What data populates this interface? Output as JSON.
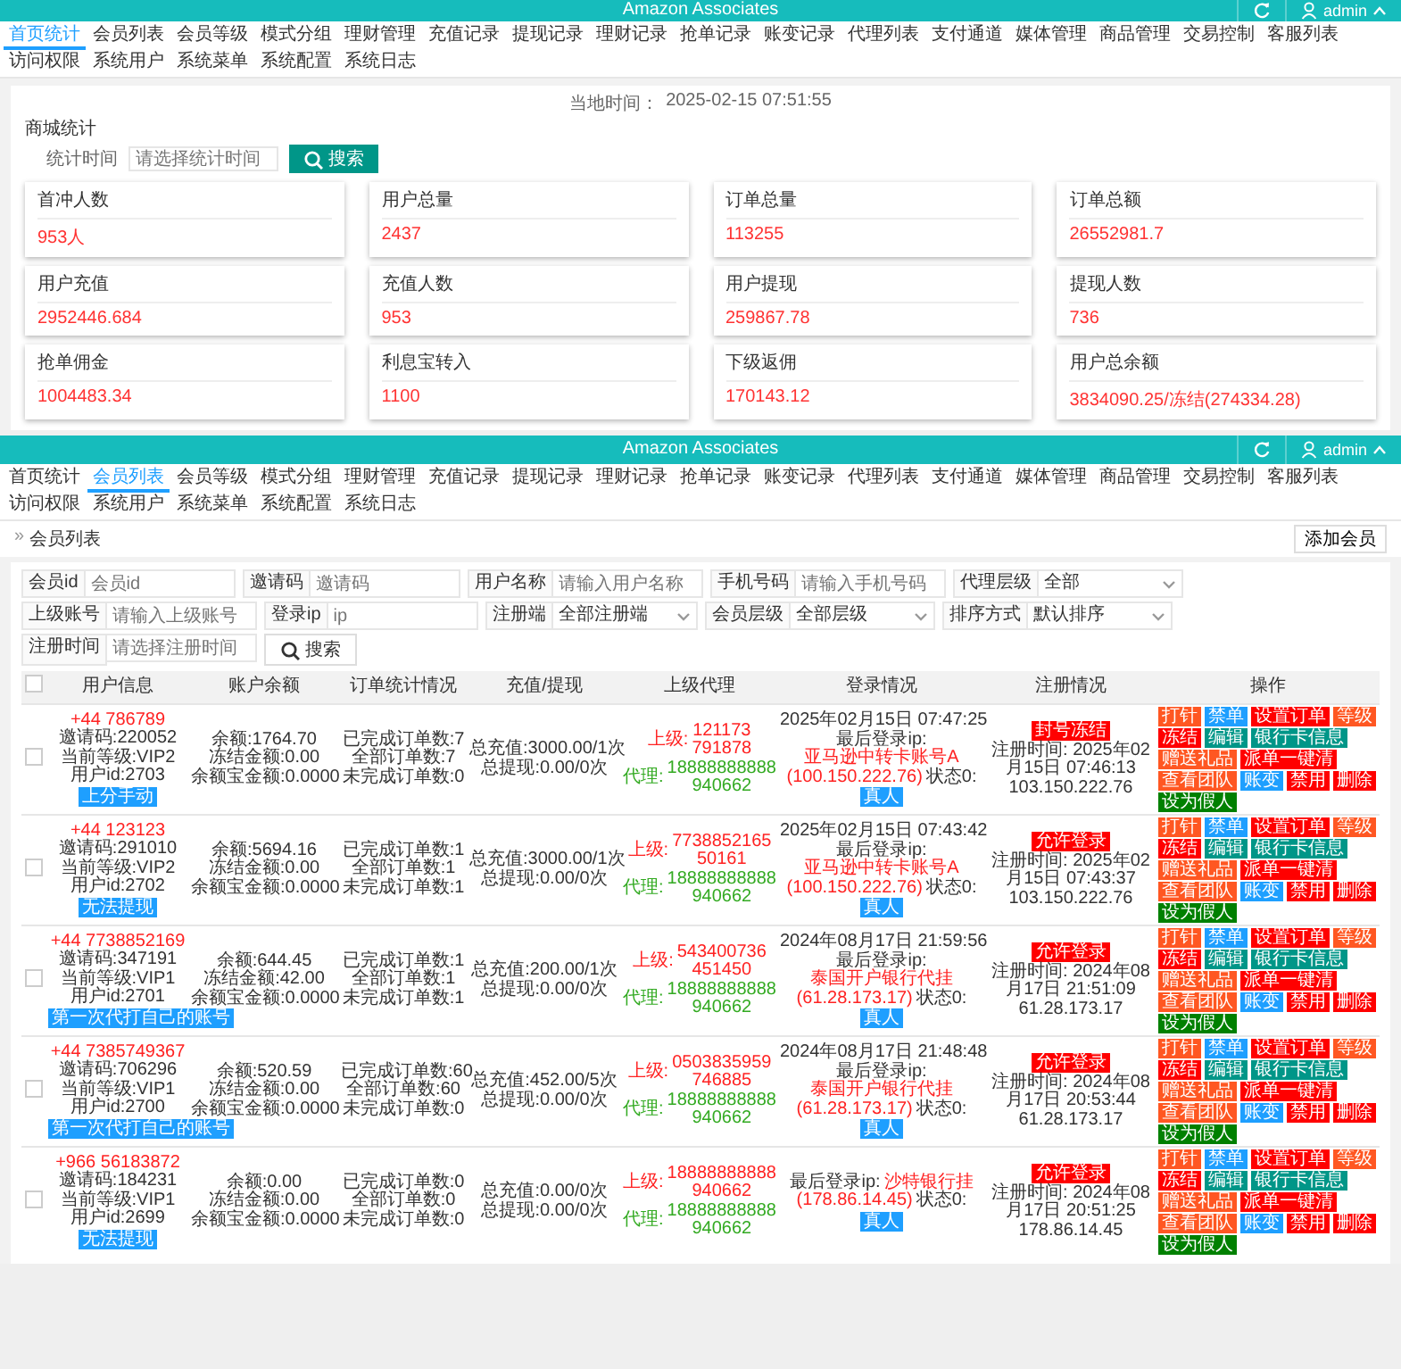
{
  "dashboard": {
    "window_title": "Amazon Associates",
    "user": "admin",
    "nav": [
      {
        "label": "首页统计",
        "selected": true
      },
      {
        "label": "会员列表",
        "selected": false
      },
      {
        "label": "会员等级",
        "selected": false
      },
      {
        "label": "模式分组",
        "selected": false
      },
      {
        "label": "理财管理",
        "selected": false
      },
      {
        "label": "充值记录",
        "selected": false
      },
      {
        "label": "提现记录",
        "selected": false
      },
      {
        "label": "理财记录",
        "selected": false
      },
      {
        "label": "抢单记录",
        "selected": false
      },
      {
        "label": "账变记录",
        "selected": false
      },
      {
        "label": "代理列表",
        "selected": false
      },
      {
        "label": "支付通道",
        "selected": false
      },
      {
        "label": "媒体管理",
        "selected": false
      },
      {
        "label": "商品管理",
        "selected": false
      },
      {
        "label": "交易控制",
        "selected": false
      },
      {
        "label": "客服列表",
        "selected": false
      },
      {
        "label": "访问权限",
        "selected": false
      },
      {
        "label": "系统用户",
        "selected": false
      },
      {
        "label": "系统菜单",
        "selected": false
      },
      {
        "label": "系统配置",
        "selected": false
      },
      {
        "label": "系统日志",
        "selected": false
      }
    ],
    "local_time_label": "当地时间：",
    "local_time": "2025-02-15 07:51:55",
    "section_title": "商城统计",
    "filter": {
      "label": "统计时间",
      "placeholder": "请选择统计时间"
    },
    "search_button": "搜索",
    "cards": [
      {
        "label": "首冲人数",
        "value": "953人"
      },
      {
        "label": "用户总量",
        "value": "2437"
      },
      {
        "label": "订单总量",
        "value": "113255"
      },
      {
        "label": "订单总额",
        "value": "26552981.7"
      },
      {
        "label": "用户充值",
        "value": "2952446.684"
      },
      {
        "label": "充值人数",
        "value": "953"
      },
      {
        "label": "用户提现",
        "value": "259867.78"
      },
      {
        "label": "提现人数",
        "value": "736"
      },
      {
        "label": "抢单佣金",
        "value": "1004483.34"
      },
      {
        "label": "利息宝转入",
        "value": "1100"
      },
      {
        "label": "下级返佣",
        "value": "170143.12"
      },
      {
        "label": "用户总余额",
        "value": "3834090.25/冻结(274334.28)"
      }
    ]
  },
  "member_list": {
    "window_title": "Amazon Associates",
    "user": "admin",
    "nav": [
      {
        "label": "首页统计",
        "selected": false
      },
      {
        "label": "会员列表",
        "selected": true
      },
      {
        "label": "会员等级",
        "selected": false
      },
      {
        "label": "模式分组",
        "selected": false
      },
      {
        "label": "理财管理",
        "selected": false
      },
      {
        "label": "充值记录",
        "selected": false
      },
      {
        "label": "提现记录",
        "selected": false
      },
      {
        "label": "理财记录",
        "selected": false
      },
      {
        "label": "抢单记录",
        "selected": false
      },
      {
        "label": "账变记录",
        "selected": false
      },
      {
        "label": "代理列表",
        "selected": false
      },
      {
        "label": "支付通道",
        "selected": false
      },
      {
        "label": "媒体管理",
        "selected": false
      },
      {
        "label": "商品管理",
        "selected": false
      },
      {
        "label": "交易控制",
        "selected": false
      },
      {
        "label": "客服列表",
        "selected": false
      },
      {
        "label": "访问权限",
        "selected": false
      },
      {
        "label": "系统用户",
        "selected": false
      },
      {
        "label": "系统菜单",
        "selected": false
      },
      {
        "label": "系统配置",
        "selected": false
      },
      {
        "label": "系统日志",
        "selected": false
      }
    ],
    "breadcrumb_mark": "»",
    "breadcrumb": "会员列表",
    "add_button": "添加会员",
    "filters": [
      {
        "kind": "input",
        "label": "会员id",
        "placeholder": "会员id"
      },
      {
        "kind": "input",
        "label": "邀请码",
        "placeholder": "邀请码"
      },
      {
        "kind": "input",
        "label": "用户名称",
        "placeholder": "请输入用户名称"
      },
      {
        "kind": "input",
        "label": "手机号码",
        "placeholder": "请输入手机号码"
      },
      {
        "kind": "select",
        "label": "代理层级",
        "value": "全部"
      },
      {
        "kind": "input",
        "label": "上级账号",
        "placeholder": "请输入上级账号"
      },
      {
        "kind": "input",
        "label": "登录ip",
        "placeholder": "ip"
      },
      {
        "kind": "select",
        "label": "注册端",
        "value": "全部注册端"
      },
      {
        "kind": "select",
        "label": "会员层级",
        "value": "全部层级"
      },
      {
        "kind": "select",
        "label": "排序方式",
        "value": "默认排序"
      },
      {
        "kind": "input",
        "label": "注册时间",
        "placeholder": "请选择注册时间"
      }
    ],
    "search_button": "搜索",
    "select_all": {
      "checked": false
    },
    "columns": [
      "用户信息",
      "账户余额",
      "订单统计情况",
      "充值/提现",
      "上级代理",
      "登录情况",
      "注册情况",
      "操作"
    ],
    "rows": [
      {
        "checked": false,
        "phone": "+44 786789",
        "details": [
          "邀请码:220052",
          "当前等级:VIP2",
          "用户id:2703"
        ],
        "tag": "上分手动",
        "balance": [
          "余额:1764.70",
          "冻结金额:0.00",
          "余额宝金额:0.0000"
        ],
        "orders": [
          "已完成订单数:7",
          "全部订单数:7",
          "未完成订单数:0"
        ],
        "recharge": [
          "总充值:3000.00/1次",
          "总提现:0.00/0次"
        ],
        "superior": {
          "label": "上级:",
          "ids": [
            "121173",
            "791878"
          ]
        },
        "agent": {
          "label": "代理:",
          "ids": [
            "18888888888",
            "940662"
          ]
        },
        "login": {
          "time": "2025年02月15日 07:47:25",
          "ip_label": "最后登录ip:",
          "ip_name": "亚马逊中转卡账号A",
          "ip": "(100.150.222.76)",
          "status": "状态0:",
          "tag": "真人"
        },
        "register": {
          "badge": "封号冻结",
          "time": "注册时间: 2025年02月15日 07:46:13",
          "ip": "103.150.222.76"
        },
        "actions": [
          {
            "label": "打针",
            "color": "#ff5722"
          },
          {
            "label": "禁单",
            "color": "#1e9fff"
          },
          {
            "label": "设置订单",
            "color": "#ff0000"
          },
          {
            "label": "等级",
            "color": "#ff5722"
          },
          {
            "label": "冻结",
            "color": "#ff0000"
          },
          {
            "label": "编辑",
            "color": "#009688"
          },
          {
            "label": "银行卡信息",
            "color": "#009688"
          },
          {
            "label": "赠送礼品",
            "color": "#ff5722"
          },
          {
            "label": "派单一键清",
            "color": "#ff0000"
          },
          {
            "label": "查看团队",
            "color": "#ff5722"
          },
          {
            "label": "账变",
            "color": "#1e9fff"
          },
          {
            "label": "禁用",
            "color": "#ff0000"
          },
          {
            "label": "删除",
            "color": "#ff0000"
          },
          {
            "label": "设为假人",
            "color": "#008000"
          }
        ]
      },
      {
        "checked": false,
        "phone": "+44 123123",
        "details": [
          "邀请码:291010",
          "当前等级:VIP2",
          "用户id:2702"
        ],
        "tag": "无法提现",
        "balance": [
          "余额:5694.16",
          "冻结金额:0.00",
          "余额宝金额:0.0000"
        ],
        "orders": [
          "已完成订单数:1",
          "全部订单数:1",
          "未完成订单数:1"
        ],
        "recharge": [
          "总充值:3000.00/1次",
          "总提现:0.00/0次"
        ],
        "superior": {
          "label": "上级:",
          "ids": [
            "7738852165",
            "50161"
          ]
        },
        "agent": {
          "label": "代理:",
          "ids": [
            "18888888888",
            "940662"
          ]
        },
        "login": {
          "time": "2025年02月15日 07:43:42",
          "ip_label": "最后登录ip:",
          "ip_name": "亚马逊中转卡账号A",
          "ip": "(100.150.222.76)",
          "status": "状态0:",
          "tag": "真人"
        },
        "register": {
          "badge": "允许登录",
          "time": "注册时间: 2025年02月15日 07:43:37",
          "ip": "103.150.222.76"
        },
        "actions": [
          {
            "label": "打针",
            "color": "#ff5722"
          },
          {
            "label": "禁单",
            "color": "#1e9fff"
          },
          {
            "label": "设置订单",
            "color": "#ff0000"
          },
          {
            "label": "等级",
            "color": "#ff5722"
          },
          {
            "label": "冻结",
            "color": "#ff0000"
          },
          {
            "label": "编辑",
            "color": "#009688"
          },
          {
            "label": "银行卡信息",
            "color": "#009688"
          },
          {
            "label": "赠送礼品",
            "color": "#ff5722"
          },
          {
            "label": "派单一键清",
            "color": "#ff0000"
          },
          {
            "label": "查看团队",
            "color": "#ff5722"
          },
          {
            "label": "账变",
            "color": "#1e9fff"
          },
          {
            "label": "禁用",
            "color": "#ff0000"
          },
          {
            "label": "删除",
            "color": "#ff0000"
          },
          {
            "label": "设为假人",
            "color": "#008000"
          }
        ]
      },
      {
        "checked": false,
        "phone": "+44 7738852169",
        "details": [
          "邀请码:347191",
          "当前等级:VIP1",
          "用户id:2701"
        ],
        "tag": "第一次代打自己的账号",
        "balance": [
          "余额:644.45",
          "冻结金额:42.00",
          "余额宝金额:0.0000"
        ],
        "orders": [
          "已完成订单数:1",
          "全部订单数:1",
          "未完成订单数:1"
        ],
        "recharge": [
          "总充值:200.00/1次",
          "总提现:0.00/0次"
        ],
        "superior": {
          "label": "上级:",
          "ids": [
            "543400736",
            "451450"
          ]
        },
        "agent": {
          "label": "代理:",
          "ids": [
            "18888888888",
            "940662"
          ]
        },
        "login": {
          "time": "2024年08月17日 21:59:56",
          "ip_label": "最后登录ip:",
          "ip_name": "泰国开户银行代挂",
          "ip": "(61.28.173.17)",
          "status": "状态0:",
          "tag": "真人"
        },
        "register": {
          "badge": "允许登录",
          "time": "注册时间: 2024年08月17日 21:51:09",
          "ip": "61.28.173.17"
        },
        "actions": [
          {
            "label": "打针",
            "color": "#ff5722"
          },
          {
            "label": "禁单",
            "color": "#1e9fff"
          },
          {
            "label": "设置订单",
            "color": "#ff0000"
          },
          {
            "label": "等级",
            "color": "#ff5722"
          },
          {
            "label": "冻结",
            "color": "#ff0000"
          },
          {
            "label": "编辑",
            "color": "#009688"
          },
          {
            "label": "银行卡信息",
            "color": "#009688"
          },
          {
            "label": "赠送礼品",
            "color": "#ff5722"
          },
          {
            "label": "派单一键清",
            "color": "#ff0000"
          },
          {
            "label": "查看团队",
            "color": "#ff5722"
          },
          {
            "label": "账变",
            "color": "#1e9fff"
          },
          {
            "label": "禁用",
            "color": "#ff0000"
          },
          {
            "label": "删除",
            "color": "#ff0000"
          },
          {
            "label": "设为假人",
            "color": "#008000"
          }
        ]
      },
      {
        "checked": false,
        "phone": "+44 7385749367",
        "details": [
          "邀请码:706296",
          "当前等级:VIP1",
          "用户id:2700"
        ],
        "tag": "第一次代打自己的账号",
        "balance": [
          "余额:520.59",
          "冻结金额:0.00",
          "余额宝金额:0.0000"
        ],
        "orders": [
          "已完成订单数:60",
          "全部订单数:60",
          "未完成订单数:0"
        ],
        "recharge": [
          "总充值:452.00/5次",
          "总提现:0.00/0次"
        ],
        "superior": {
          "label": "上级:",
          "ids": [
            "0503835959",
            "746885"
          ]
        },
        "agent": {
          "label": "代理:",
          "ids": [
            "18888888888",
            "940662"
          ]
        },
        "login": {
          "time": "2024年08月17日 21:48:48",
          "ip_label": "最后登录ip:",
          "ip_name": "泰国开户银行代挂",
          "ip": "(61.28.173.17)",
          "status": "状态0:",
          "tag": "真人"
        },
        "register": {
          "badge": "允许登录",
          "time": "注册时间: 2024年08月17日 20:53:44",
          "ip": "61.28.173.17"
        },
        "actions": [
          {
            "label": "打针",
            "color": "#ff5722"
          },
          {
            "label": "禁单",
            "color": "#1e9fff"
          },
          {
            "label": "设置订单",
            "color": "#ff0000"
          },
          {
            "label": "等级",
            "color": "#ff5722"
          },
          {
            "label": "冻结",
            "color": "#ff0000"
          },
          {
            "label": "编辑",
            "color": "#009688"
          },
          {
            "label": "银行卡信息",
            "color": "#009688"
          },
          {
            "label": "赠送礼品",
            "color": "#ff5722"
          },
          {
            "label": "派单一键清",
            "color": "#ff0000"
          },
          {
            "label": "查看团队",
            "color": "#ff5722"
          },
          {
            "label": "账变",
            "color": "#1e9fff"
          },
          {
            "label": "禁用",
            "color": "#ff0000"
          },
          {
            "label": "删除",
            "color": "#ff0000"
          },
          {
            "label": "设为假人",
            "color": "#008000"
          }
        ]
      },
      {
        "checked": false,
        "phone": "+966 56183872",
        "details": [
          "邀请码:184231",
          "当前等级:VIP1",
          "用户id:2699"
        ],
        "tag": "无法提现",
        "balance": [
          "余额:0.00",
          "冻结金额:0.00",
          "余额宝金额:0.0000"
        ],
        "orders": [
          "已完成订单数:0",
          "全部订单数:0",
          "未完成订单数:0"
        ],
        "recharge": [
          "总充值:0.00/0次",
          "总提现:0.00/0次"
        ],
        "superior": {
          "label": "上级:",
          "ids": [
            "18888888888",
            "940662"
          ]
        },
        "agent": {
          "label": "代理:",
          "ids": [
            "18888888888",
            "940662"
          ]
        },
        "login": {
          "ip_label": "最后登录ip:",
          "ip_name": "沙特银行挂",
          "ip": "(178.86.14.45)",
          "status": "状态0:",
          "tag": "真人"
        },
        "register": {
          "badge": "允许登录",
          "time": "注册时间: 2024年08月17日 20:51:25",
          "ip": "178.86.14.45"
        },
        "actions": [
          {
            "label": "打针",
            "color": "#ff5722"
          },
          {
            "label": "禁单",
            "color": "#1e9fff"
          },
          {
            "label": "设置订单",
            "color": "#ff0000"
          },
          {
            "label": "等级",
            "color": "#ff5722"
          },
          {
            "label": "冻结",
            "color": "#ff0000"
          },
          {
            "label": "编辑",
            "color": "#009688"
          },
          {
            "label": "银行卡信息",
            "color": "#009688"
          },
          {
            "label": "赠送礼品",
            "color": "#ff5722"
          },
          {
            "label": "派单一键清",
            "color": "#ff0000"
          },
          {
            "label": "查看团队",
            "color": "#ff5722"
          },
          {
            "label": "账变",
            "color": "#1e9fff"
          },
          {
            "label": "禁用",
            "color": "#ff0000"
          },
          {
            "label": "删除",
            "color": "#ff0000"
          },
          {
            "label": "设为假人",
            "color": "#008000"
          }
        ]
      }
    ]
  }
}
